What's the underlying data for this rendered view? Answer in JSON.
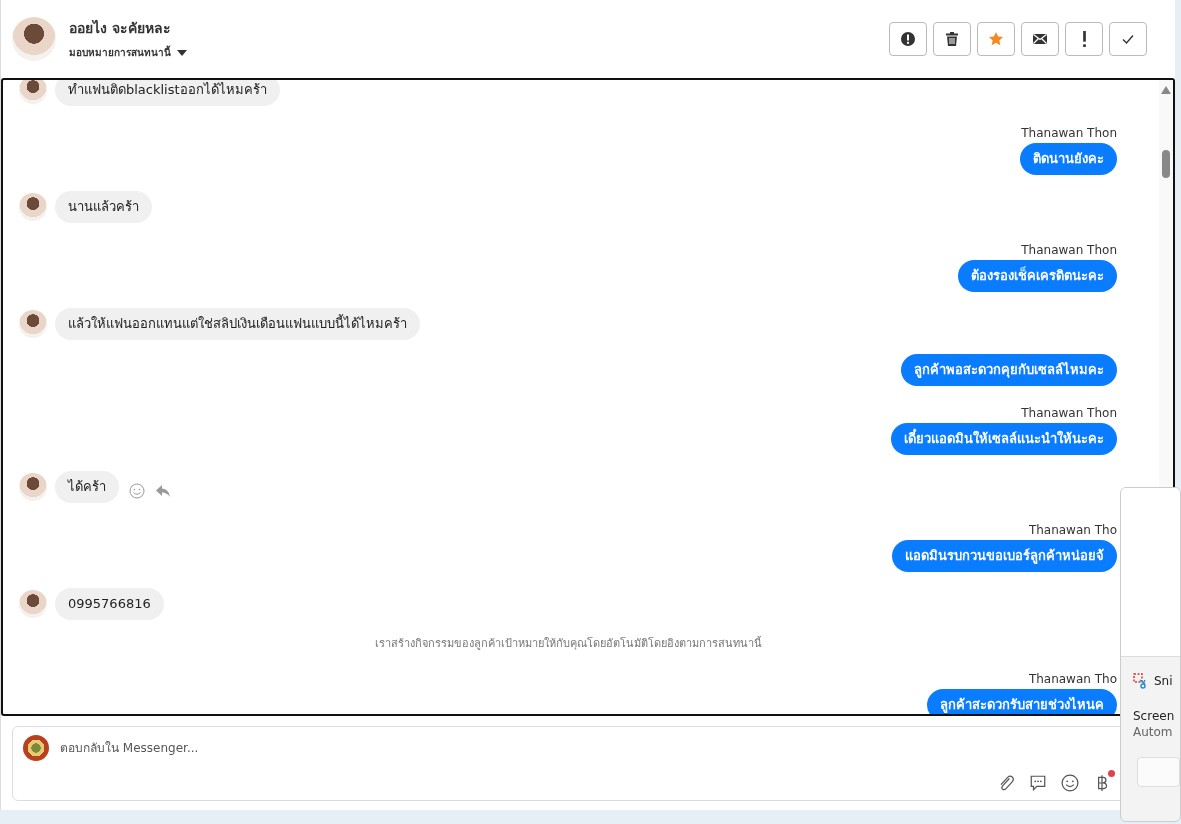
{
  "header": {
    "name": "ออยไง จะคัยหละ",
    "assign_label": "มอบหมายการสนทนานี้",
    "actions": [
      {
        "kind": "report"
      },
      {
        "kind": "delete"
      },
      {
        "kind": "star",
        "on": true
      },
      {
        "kind": "mail"
      },
      {
        "kind": "important"
      },
      {
        "kind": "done"
      }
    ]
  },
  "messages": [
    {
      "kind": "incoming",
      "text": "ทำแฟนติดblacklistออกได้ไหมคร้า"
    },
    {
      "kind": "outgoing",
      "sender": "Thanawan Thon",
      "text": "ติดนานยังคะ"
    },
    {
      "kind": "incoming",
      "text": "นานแล้วคร้า"
    },
    {
      "kind": "outgoing",
      "sender": "Thanawan Thon",
      "text": "ต้องรองเช็คเครดิตนะคะ"
    },
    {
      "kind": "incoming",
      "text": "แล้วให้แฟนออกแทนแต่ใช่สลิปเงินเดือนแฟนแบบนี้ได้ไหมคร้า"
    },
    {
      "kind": "outgoing",
      "text": "ลูกค้าพอสะดวกคุยกับเซลล์ไหมคะ"
    },
    {
      "kind": "outgoing",
      "sender": "Thanawan Thon",
      "text": "เดี๋ยวแอดมินให้เซลล์แนะนำให้นะคะ"
    },
    {
      "kind": "incoming",
      "text": "ได้คร้า",
      "hovered": true
    },
    {
      "kind": "outgoing",
      "sender": "Thanawan Tho",
      "text": "แอดมินรบกวนขอเบอร์ลูกค้าหน่อยจ้"
    },
    {
      "kind": "incoming",
      "text": "0995766816"
    },
    {
      "kind": "system",
      "text": "เราสร้างกิจกรรมของลูกค้าเป้าหมายให้กับคุณโดยอัตโนมัติโดยอิงตามการสนทนานี้"
    },
    {
      "kind": "outgoing",
      "sender": "Thanawan Tho",
      "text": "ลูกค้าสะดวกรับสายช่วงไหนค"
    }
  ],
  "composer": {
    "placeholder": "ตอบกลับใน Messenger...",
    "has_notification": true
  },
  "notification": {
    "app": "Sni",
    "title": "Screen",
    "subtitle": "Autom"
  }
}
